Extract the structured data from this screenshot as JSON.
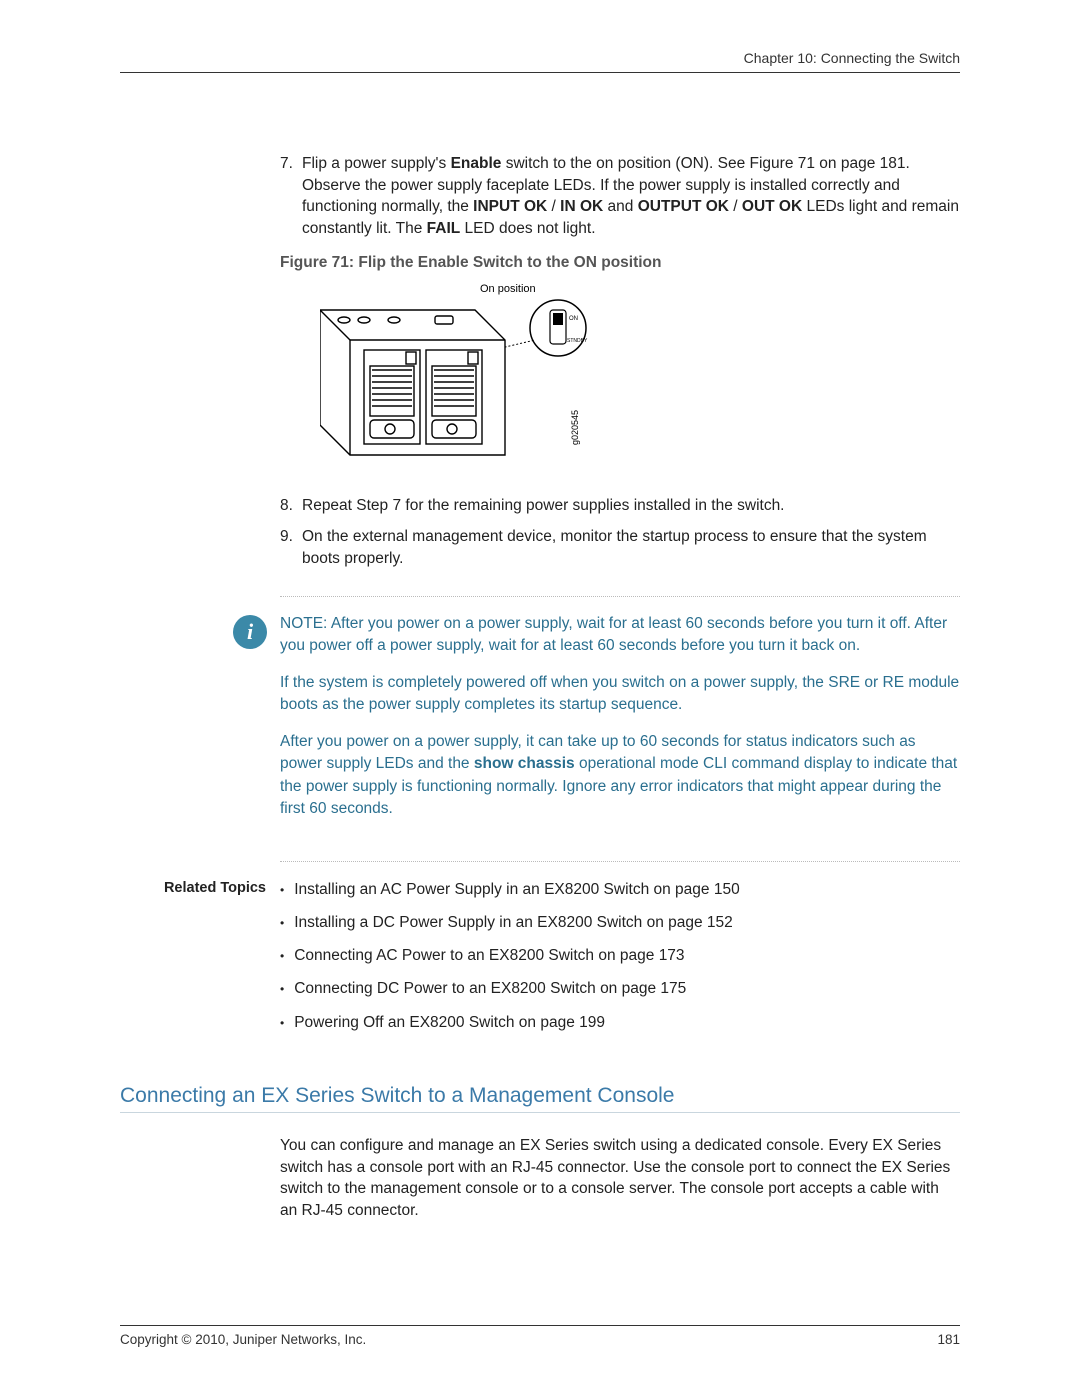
{
  "header": {
    "chapter": "Chapter 10: Connecting the Switch"
  },
  "steps_a": {
    "item7": {
      "num": "7.",
      "pre": "Flip a power supply's ",
      "bold1": "Enable",
      "mid1": " switch to the on position (ON). See Figure 71 on page 181. Observe the power supply faceplate LEDs. If the power supply is installed correctly and functioning normally, the ",
      "bold2": "INPUT OK",
      "mid2": " / ",
      "bold3": "IN OK",
      "mid3": " and ",
      "bold4": "OUTPUT OK",
      "mid4": " / ",
      "bold5": "OUT OK",
      "mid5": " LEDs light and remain constantly lit. The ",
      "bold6": "FAIL",
      "tail": " LED does not light."
    }
  },
  "figure": {
    "title": "Figure 71: Flip the Enable Switch to the ON position",
    "label_on": "On position",
    "code": "g020545"
  },
  "steps_b": {
    "item8": {
      "num": "8.",
      "text": "Repeat Step 7 for the remaining power supplies installed in the switch."
    },
    "item9": {
      "num": "9.",
      "text": "On the external management device, monitor the startup process to ensure that the system boots properly."
    }
  },
  "note": {
    "p1": "NOTE:  After you power on a power supply, wait for at least 60 seconds before you turn it off. After you power off a power supply, wait for at least 60 seconds before you turn it back on.",
    "p2": "If the system is completely powered off when you switch on a power supply, the SRE or RE module boots as the power supply completes its startup sequence.",
    "p3_pre": "After you power on a power supply, it can take up to 60 seconds for status indicators such as power supply LEDs and the ",
    "p3_bold": "show chassis",
    "p3_post": " operational mode CLI command display to indicate that the power supply is functioning normally. Ignore any error indicators that might appear during the first 60 seconds."
  },
  "related": {
    "label": "Related Topics",
    "items": [
      "Installing an AC Power Supply in an EX8200 Switch on page 150",
      "Installing a DC Power Supply in an EX8200 Switch on page 152",
      "Connecting AC Power to an EX8200 Switch on page 173",
      "Connecting DC Power to an EX8200 Switch on page 175",
      "Powering Off an EX8200 Switch on page 199"
    ]
  },
  "section": {
    "title": "Connecting an EX Series Switch to a Management Console",
    "body": "You can configure and manage an EX Series switch using a dedicated console. Every EX Series switch has a console port with an RJ-45 connector. Use the console port to connect the EX Series switch to the management console or to a console server. The console port accepts a cable with an RJ-45 connector."
  },
  "footer": {
    "copyright": "Copyright © 2010, Juniper Networks, Inc.",
    "page": "181"
  }
}
